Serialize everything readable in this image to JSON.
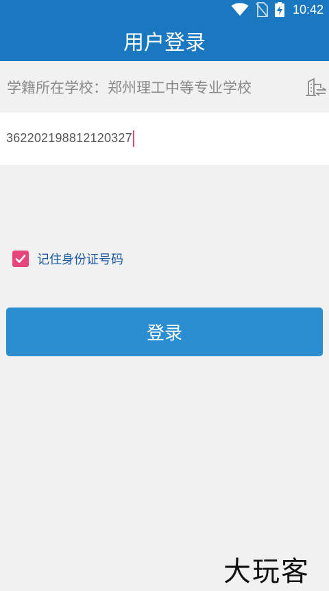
{
  "status_bar": {
    "time": "10:42",
    "icons": [
      "wifi-icon",
      "no-sim-icon",
      "battery-charging-icon"
    ]
  },
  "app_bar": {
    "title": "用户登录"
  },
  "school": {
    "label": "学籍所在学校：",
    "name": "郑州理工中等专业学校",
    "switch_icon": "switch-school-icon"
  },
  "id_field": {
    "value": "362202198812120327"
  },
  "remember": {
    "label": "记住身份证号码",
    "checked": true
  },
  "login_button": {
    "label": "登录"
  },
  "watermark": {
    "text": "大玩客"
  },
  "colors": {
    "primary": "#1a78c0",
    "button": "#2b8ed0",
    "checkbox": "#e8457d",
    "background": "#f1f1f1"
  }
}
